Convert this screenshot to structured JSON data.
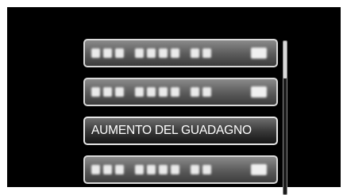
{
  "menu": {
    "items": [
      {
        "label": "",
        "value": "",
        "masked": true,
        "selected": false
      },
      {
        "label": "",
        "value": "",
        "masked": true,
        "selected": false
      },
      {
        "label": "AUMENTO DEL GUADAGNO",
        "value": "",
        "masked": false,
        "selected": true
      },
      {
        "label": "",
        "value": "",
        "masked": true,
        "selected": false
      }
    ]
  },
  "scroll": {
    "position_fraction": 0.0,
    "visible_fraction": 0.25
  },
  "colors": {
    "background": "#000000",
    "item_border": "#d9d9d9",
    "text": "#ffffff"
  }
}
